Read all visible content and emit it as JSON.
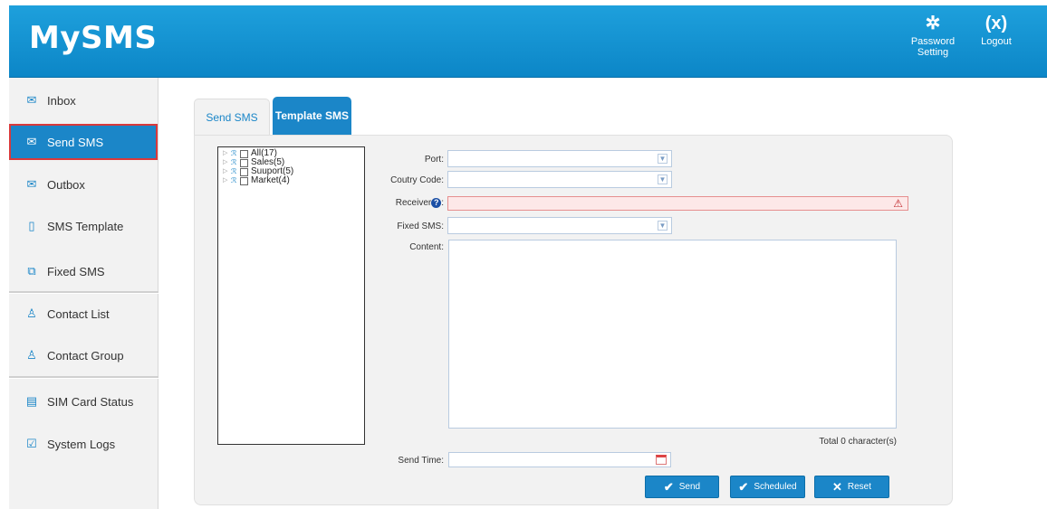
{
  "header": {
    "brand": "MySMS",
    "password_setting_label": "Password\nSetting",
    "logout_label": "Logout",
    "gear_icon": "gear-icon",
    "logout_icon": "x-circle-icon"
  },
  "sidebar": {
    "items": [
      {
        "label": "Inbox",
        "icon": "envelope-icon"
      },
      {
        "label": "Send SMS",
        "icon": "envelope-send-icon",
        "active": true
      },
      {
        "label": "Outbox",
        "icon": "envelope-open-icon"
      },
      {
        "label": "SMS Template",
        "icon": "document-icon"
      },
      {
        "label": "Fixed SMS",
        "icon": "chat-icon"
      },
      {
        "label": "Contact List",
        "icon": "person-icon"
      },
      {
        "label": "Contact Group",
        "icon": "people-icon"
      },
      {
        "label": "SIM Card Status",
        "icon": "file-icon"
      },
      {
        "label": "System Logs",
        "icon": "edit-icon"
      }
    ]
  },
  "tabs": [
    {
      "label": "Send SMS"
    },
    {
      "label": "Template SMS"
    }
  ],
  "contact_tree": [
    {
      "label": "All(17)"
    },
    {
      "label": "Sales(5)"
    },
    {
      "label": "Suuport(5)"
    },
    {
      "label": "Market(4)"
    }
  ],
  "form": {
    "port_label": "Port:",
    "port_value": "",
    "country_code_label": "Coutry Code:",
    "country_code_value": "",
    "receiver_label": "Receiver",
    "receiver_suffix": ":",
    "receiver_value": "",
    "fixed_sms_label": "Fixed SMS:",
    "fixed_sms_value": "",
    "content_label": "Content:",
    "content_value": "",
    "total_chars": "Total 0 character(s)",
    "send_time_label": "Send Time:",
    "send_time_value": ""
  },
  "buttons": {
    "send": "Send",
    "scheduled": "Scheduled",
    "reset": "Reset"
  },
  "colors": {
    "accent": "#1b86c8",
    "header": "#1ea0dc",
    "active_outline": "#d9393b",
    "warning": "#c0262a"
  }
}
